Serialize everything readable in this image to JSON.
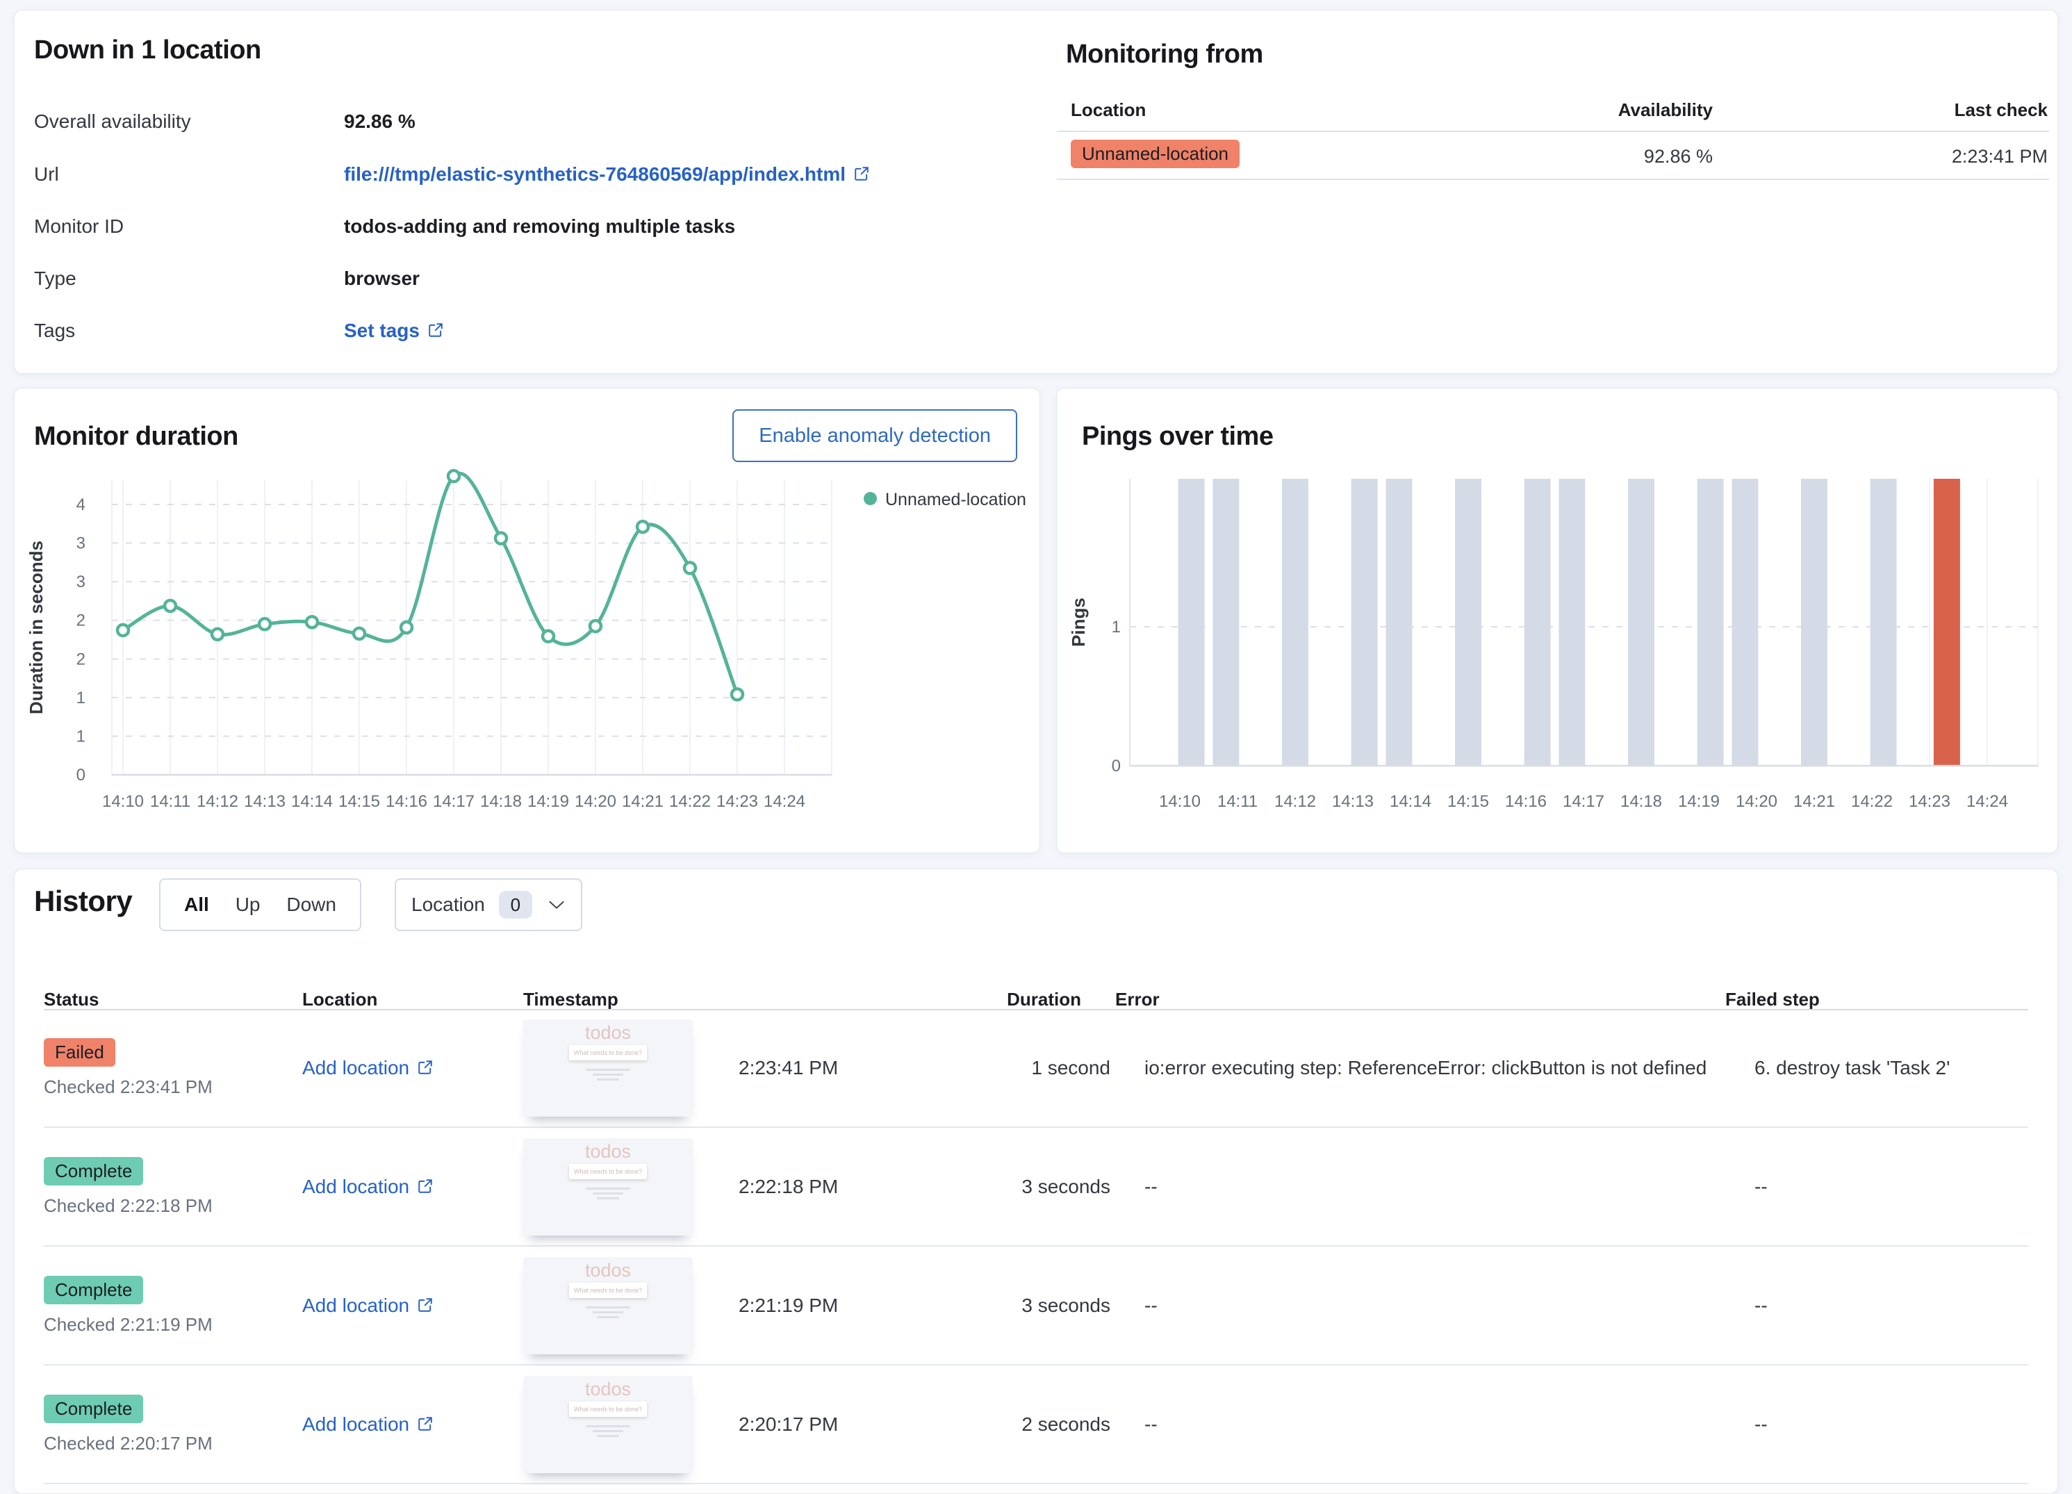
{
  "colors": {
    "accent_green": "#54b399",
    "badge_green": "#6dccb1",
    "badge_red": "#ef8268",
    "bar_gray": "#d5dbe6",
    "bar_red": "#d9624b",
    "link_blue": "#2661c5"
  },
  "status_panel": {
    "title": "Down in 1 location",
    "fields": [
      {
        "label": "Overall availability",
        "value": "92.86 %"
      },
      {
        "label": "Url",
        "value": "file:///tmp/elastic-synthetics-764860569/app/index.html"
      },
      {
        "label": "Monitor ID",
        "value": "todos-adding and removing multiple tasks"
      },
      {
        "label": "Type",
        "value": "browser"
      },
      {
        "label": "Tags",
        "value": "Set tags"
      }
    ]
  },
  "monitoring_from": {
    "title": "Monitoring from",
    "columns": [
      "Location",
      "Availability",
      "Last check"
    ],
    "row": {
      "location": "Unnamed-location",
      "availability": "92.86 %",
      "last_check": "2:23:41 PM"
    }
  },
  "monitor_duration": {
    "title": "Monitor duration",
    "button_label": "Enable anomaly detection",
    "legend_label": "Unnamed-location"
  },
  "pings_panel": {
    "title": "Pings over time"
  },
  "history": {
    "title": "History",
    "filter_group": [
      "All",
      "Up",
      "Down"
    ],
    "filter_selected": "All",
    "location_filter": {
      "label": "Location",
      "count": "0"
    },
    "columns": [
      "Status",
      "Location",
      "Timestamp",
      "Duration",
      "Error",
      "Failed step"
    ],
    "thumbnail": {
      "title": "todos",
      "placeholder": "What needs to be done?"
    },
    "rows": [
      {
        "status": "Failed",
        "checked": "Checked 2:23:41 PM",
        "location": "Add location",
        "timestamp": "2:23:41 PM",
        "duration": "1 second",
        "error": "io:error executing step: ReferenceError: clickButton is not defined",
        "failed_step": "6. destroy task 'Task 2'"
      },
      {
        "status": "Complete",
        "checked": "Checked 2:22:18 PM",
        "location": "Add location",
        "timestamp": "2:22:18 PM",
        "duration": "3 seconds",
        "error": "--",
        "failed_step": "--"
      },
      {
        "status": "Complete",
        "checked": "Checked 2:21:19 PM",
        "location": "Add location",
        "timestamp": "2:21:19 PM",
        "duration": "3 seconds",
        "error": "--",
        "failed_step": "--"
      },
      {
        "status": "Complete",
        "checked": "Checked 2:20:17 PM",
        "location": "Add location",
        "timestamp": "2:20:17 PM",
        "duration": "2 seconds",
        "error": "--",
        "failed_step": "--"
      }
    ]
  },
  "chart_data": [
    {
      "type": "line",
      "title": "Monitor duration",
      "ylabel": "Duration in seconds",
      "xlabel": "",
      "categories": [
        "14:10",
        "14:11",
        "14:12",
        "14:13",
        "14:14",
        "14:15",
        "14:16",
        "14:17",
        "14:18",
        "14:19",
        "14:20",
        "14:21",
        "14:22",
        "14:23",
        "14:24"
      ],
      "series": [
        {
          "name": "Unnamed-location",
          "color": "#54b399",
          "values": [
            2.14,
            2.5,
            2.08,
            2.23,
            2.26,
            2.09,
            2.18,
            4.42,
            3.5,
            2.05,
            2.2,
            3.67,
            3.06,
            1.19
          ]
        }
      ],
      "ylim": [
        0,
        4.6
      ],
      "y_ticks": [
        {
          "value": 0,
          "label": "0"
        },
        {
          "value": 0.571,
          "label": "1"
        },
        {
          "value": 1.143,
          "label": "1"
        },
        {
          "value": 1.714,
          "label": "2"
        },
        {
          "value": 2.286,
          "label": "2"
        },
        {
          "value": 2.857,
          "label": "3"
        },
        {
          "value": 3.429,
          "label": "3"
        },
        {
          "value": 4,
          "label": "4"
        }
      ],
      "grid": true,
      "legend_position": "right"
    },
    {
      "type": "bar",
      "title": "Pings over time",
      "ylabel": "Pings",
      "xlabel": "",
      "categories": [
        "14:10",
        "14:11",
        "14:12",
        "14:13",
        "14:14",
        "14:15",
        "14:16",
        "14:17",
        "14:18",
        "14:19",
        "14:20",
        "14:21",
        "14:22",
        "14:23",
        "14:24"
      ],
      "y_ticks": [
        {
          "value": 0,
          "label": "0"
        },
        {
          "value": 1,
          "label": "1"
        }
      ],
      "bar_colors": {
        "up": "#d5dbe6",
        "down": "#d9624b"
      },
      "bars": [
        {
          "x_minute_offset": 0.2,
          "count": 1,
          "status": "up"
        },
        {
          "x_minute_offset": 0.8,
          "count": 1,
          "status": "up"
        },
        {
          "x_minute_offset": 2.0,
          "count": 1,
          "status": "up"
        },
        {
          "x_minute_offset": 3.2,
          "count": 1,
          "status": "up"
        },
        {
          "x_minute_offset": 3.8,
          "count": 1,
          "status": "up"
        },
        {
          "x_minute_offset": 5.0,
          "count": 1,
          "status": "up"
        },
        {
          "x_minute_offset": 6.2,
          "count": 1,
          "status": "up"
        },
        {
          "x_minute_offset": 6.8,
          "count": 1,
          "status": "up"
        },
        {
          "x_minute_offset": 8.0,
          "count": 1,
          "status": "up"
        },
        {
          "x_minute_offset": 9.2,
          "count": 1,
          "status": "up"
        },
        {
          "x_minute_offset": 9.8,
          "count": 1,
          "status": "up"
        },
        {
          "x_minute_offset": 11.0,
          "count": 1,
          "status": "up"
        },
        {
          "x_minute_offset": 12.2,
          "count": 1,
          "status": "up"
        },
        {
          "x_minute_offset": 13.3,
          "count": 1,
          "status": "down"
        }
      ],
      "grid": true
    }
  ]
}
